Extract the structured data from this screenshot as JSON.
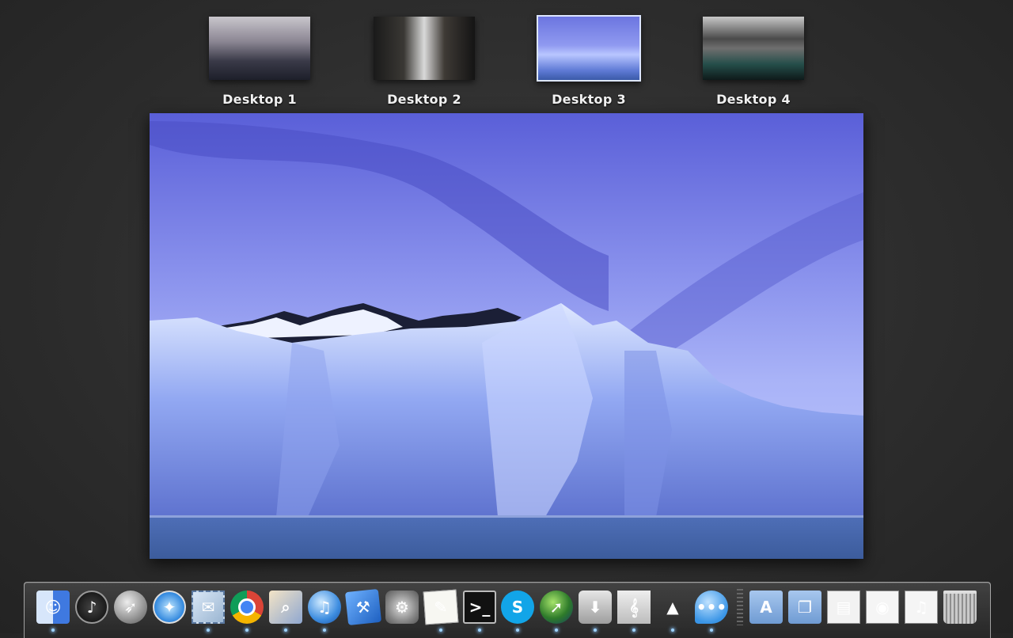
{
  "spaces": [
    {
      "label": "Desktop 1",
      "selected": false,
      "wallpaper": "foggy-forest"
    },
    {
      "label": "Desktop 2",
      "selected": false,
      "wallpaper": "canyon-path"
    },
    {
      "label": "Desktop 3",
      "selected": true,
      "wallpaper": "blue-glacier"
    },
    {
      "label": "Desktop 4",
      "selected": false,
      "wallpaper": "mountain-lake"
    }
  ],
  "current_desktop": {
    "wallpaper": "blue-glacier"
  },
  "dock": {
    "items": [
      {
        "name": "finder-icon",
        "glyph": "☺",
        "running": true
      },
      {
        "name": "dashboard-icon",
        "glyph": "♪",
        "running": false
      },
      {
        "name": "launchpad-icon",
        "glyph": "➶",
        "running": false
      },
      {
        "name": "safari-icon",
        "glyph": "✦",
        "running": false
      },
      {
        "name": "mail-icon",
        "glyph": "✉",
        "running": true
      },
      {
        "name": "chrome-icon",
        "glyph": "",
        "running": true
      },
      {
        "name": "preview-icon",
        "glyph": "⌕",
        "running": true
      },
      {
        "name": "itunes-icon",
        "glyph": "♫",
        "running": true
      },
      {
        "name": "xcode-icon",
        "glyph": "⚒",
        "running": false
      },
      {
        "name": "system-preferences-icon",
        "glyph": "⚙",
        "running": false
      },
      {
        "name": "textedit-icon",
        "glyph": "✎",
        "running": true
      },
      {
        "name": "terminal-icon",
        "glyph": ">_",
        "running": true
      },
      {
        "name": "skype-icon",
        "glyph": "S",
        "running": true
      },
      {
        "name": "globe-app-icon",
        "glyph": "➚",
        "running": true
      },
      {
        "name": "transmission-icon",
        "glyph": "⬇",
        "running": true
      },
      {
        "name": "musescore-icon",
        "glyph": "𝄞",
        "running": true
      },
      {
        "name": "vlc-icon",
        "glyph": "▲",
        "running": true
      },
      {
        "name": "messages-icon",
        "glyph": "•••",
        "running": true
      },
      {
        "name": "applications-folder-icon",
        "glyph": "A",
        "running": false
      },
      {
        "name": "documents-folder-icon",
        "glyph": "❐",
        "running": false
      },
      {
        "name": "downloads-stack-icon",
        "glyph": "▤",
        "running": false
      },
      {
        "name": "chrome-window-icon",
        "glyph": "◉",
        "running": false
      },
      {
        "name": "itunes-window-icon",
        "glyph": "♫",
        "running": false
      },
      {
        "name": "trash-icon",
        "glyph": "",
        "running": false
      }
    ]
  },
  "colors": {
    "selection_border": "#dde6ff",
    "running_indicator": "#9fd3ff"
  }
}
